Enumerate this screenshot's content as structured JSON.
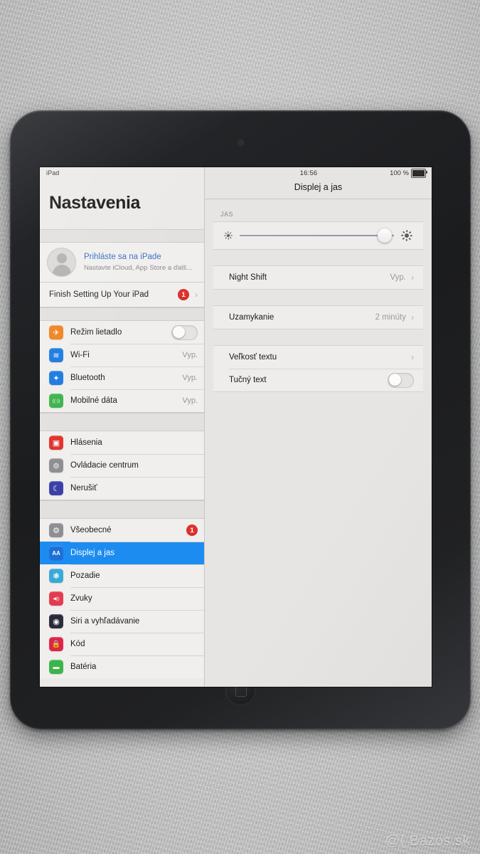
{
  "watermark": "@( Bazos.sk",
  "sidebar": {
    "status_device_label": "iPad",
    "title": "Nastavenia",
    "account": {
      "title": "Prihláste sa na iPade",
      "subtitle": "Nastavte iCloud, App Store a ďalš...",
      "avatar_icon": "person-avatar-icon"
    },
    "finish_setup": {
      "label": "Finish Setting Up Your iPad",
      "badge": "1",
      "chevron": "›"
    },
    "group1": [
      {
        "label": "Režim lietadlo",
        "icon": "airplane-icon",
        "color": "#ef8420",
        "glyph": "✈",
        "control": "toggle",
        "value": ""
      },
      {
        "label": "Wi-Fi",
        "icon": "wifi-icon",
        "color": "#1c7ae0",
        "glyph": "≋",
        "control": "value",
        "value": "Vyp."
      },
      {
        "label": "Bluetooth",
        "icon": "bluetooth-icon",
        "color": "#1c7ae0",
        "glyph": "✦",
        "control": "value",
        "value": "Vyp."
      },
      {
        "label": "Mobilné dáta",
        "icon": "cellular-data-icon",
        "color": "#3bb54a",
        "glyph": "((∙))",
        "control": "value",
        "value": "Vyp."
      }
    ],
    "group2": [
      {
        "label": "Hlásenia",
        "icon": "notifications-icon",
        "color": "#e0322c",
        "glyph": "▣"
      },
      {
        "label": "Ovládacie centrum",
        "icon": "control-center-icon",
        "color": "#8e8e93",
        "glyph": "⊜"
      },
      {
        "label": "Nerušiť",
        "icon": "do-not-disturb-icon",
        "color": "#3b3fa8",
        "glyph": "☾"
      }
    ],
    "group3": [
      {
        "label": "Všeobecné",
        "icon": "general-gear-icon",
        "color": "#8e8e93",
        "glyph": "⚙",
        "badge": "1",
        "selected": false
      },
      {
        "label": "Displej a jas",
        "icon": "display-brightness-icon",
        "color": "#1c6fd6",
        "glyph": "AA",
        "selected": true
      },
      {
        "label": "Pozadie",
        "icon": "wallpaper-icon",
        "color": "#3aa8d8",
        "glyph": "❃",
        "selected": false
      },
      {
        "label": "Zvuky",
        "icon": "sounds-icon",
        "color": "#e33b4e",
        "glyph": "◀))",
        "selected": false
      },
      {
        "label": "Siri a vyhľadávanie",
        "icon": "siri-search-icon",
        "color": "#2a2a3a",
        "glyph": "◉",
        "selected": false
      },
      {
        "label": "Kód",
        "icon": "passcode-lock-icon",
        "color": "#e02448",
        "glyph": "🔒",
        "selected": false
      },
      {
        "label": "Batéria",
        "icon": "battery-icon",
        "color": "#3bb54a",
        "glyph": "▬",
        "selected": false
      }
    ]
  },
  "detail": {
    "status": {
      "time": "16:56",
      "battery_percent": "100 %",
      "battery_icon": "battery-full-icon"
    },
    "nav_title": "Displej a jas",
    "brightness": {
      "group_label": "JAS",
      "min_icon": "sun-small-icon",
      "max_icon": "sun-large-icon",
      "value_percent": 94
    },
    "rows": [
      {
        "label": "Night Shift",
        "value": "Vyp.",
        "chevron": "›",
        "control": "link"
      },
      {
        "label": "Uzamykanie",
        "value": "2 minúty",
        "chevron": "›",
        "control": "link"
      },
      {
        "label": "Veľkosť textu",
        "value": "",
        "chevron": "›",
        "control": "link"
      },
      {
        "label": "Tučný text",
        "value": "",
        "chevron": "",
        "control": "toggle"
      }
    ]
  }
}
